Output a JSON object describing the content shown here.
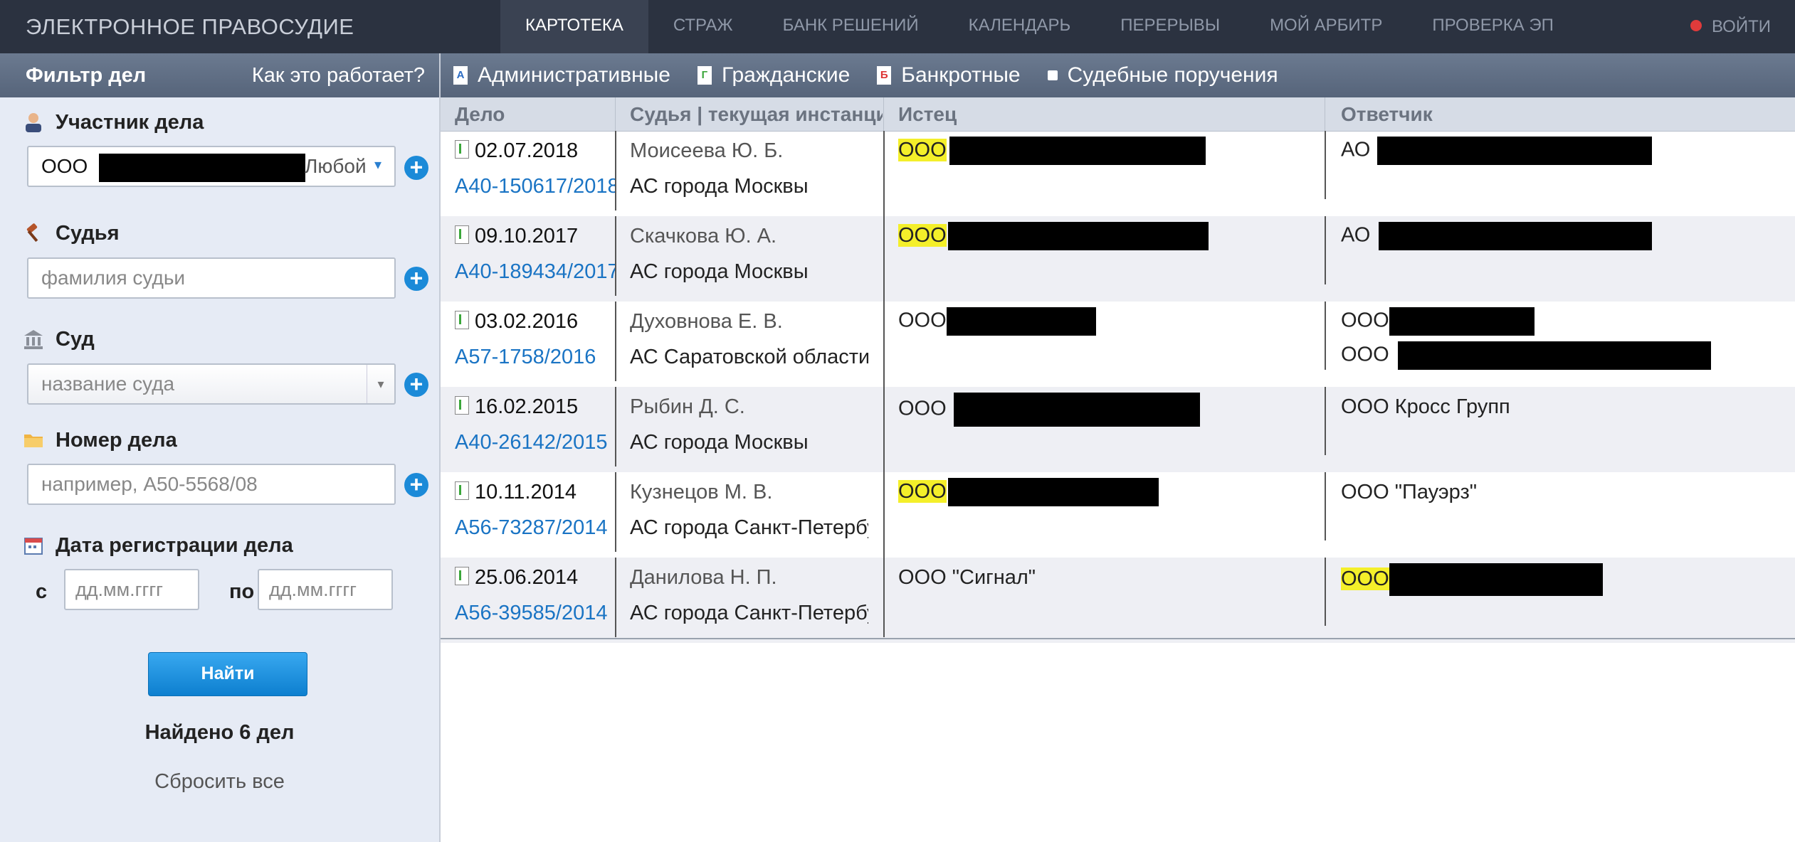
{
  "header": {
    "brand": "ЭЛЕКТРОННОЕ ПРАВОСУДИЕ",
    "nav": [
      "КАРТОТЕКА",
      "СТРАЖ",
      "БАНК РЕШЕНИЙ",
      "КАЛЕНДАРЬ",
      "ПЕРЕРЫВЫ",
      "МОЙ АРБИТР",
      "ПРОВЕРКА ЭП"
    ],
    "active_nav": "КАРТОТЕКА",
    "login": "ВОЙТИ"
  },
  "sidebar": {
    "title": "Фильтр дел",
    "how": "Как это работает?",
    "participant_label": "Участник дела",
    "participant_value": "ООО",
    "participant_role": "Любой",
    "judge_label": "Судья",
    "judge_placeholder": "фамилия судьи",
    "court_label": "Суд",
    "court_placeholder": "название суда",
    "case_label": "Номер дела",
    "case_placeholder": "например, А50-5568/08",
    "date_label": "Дата регистрации дела",
    "date_from": "с",
    "date_to": "по",
    "date_placeholder": "дд.мм.гггг",
    "find_button": "Найти",
    "found": "Найдено 6 дел",
    "reset": "Сбросить все"
  },
  "tabs": [
    {
      "label": "Административные",
      "icon": "А"
    },
    {
      "label": "Гражданские",
      "icon": "Г"
    },
    {
      "label": "Банкротные",
      "icon": "Б"
    },
    {
      "label": "Судебные поручения",
      "icon": ""
    }
  ],
  "table": {
    "columns": [
      "Дело",
      "Судья | текущая инстанция",
      "Истец",
      "Ответчик"
    ],
    "rows": [
      {
        "date": "02.07.2018",
        "number": "А40-150617/2018",
        "judge": "Моисеева Ю. Б.",
        "court": "АС города Москвы",
        "plaintiff": "ООО",
        "plaintiff_hl": true,
        "defendant": [
          "АО"
        ],
        "defendant_hl": false
      },
      {
        "date": "09.10.2017",
        "number": "А40-189434/2017",
        "judge": "Скачкова Ю. А.",
        "court": "АС города Москвы",
        "plaintiff": "ООО",
        "plaintiff_hl": true,
        "defendant": [
          "АО"
        ],
        "defendant_hl": false
      },
      {
        "date": "03.02.2016",
        "number": "А57-1758/2016",
        "judge": "Духовнова Е. В.",
        "court": "АС Саратовской области",
        "plaintiff": "ООО",
        "plaintiff_hl": false,
        "defendant": [
          "ООО",
          "ООО"
        ],
        "defendant_hl": false
      },
      {
        "date": "16.02.2015",
        "number": "А40-26142/2015",
        "judge": "Рыбин Д. С.",
        "court": "АС города Москвы",
        "plaintiff": "ООО",
        "plaintiff_hl": false,
        "defendant": [
          "ООО Кросс Групп"
        ],
        "defendant_hl": false
      },
      {
        "date": "10.11.2014",
        "number": "А56-73287/2014",
        "judge": "Кузнецов М. В.",
        "court": "АС города Санкт-Петербурга",
        "plaintiff": "ООО",
        "plaintiff_hl": true,
        "defendant": [
          "ООО \"Пауэрз\""
        ],
        "defendant_hl": false
      },
      {
        "date": "25.06.2014",
        "number": "А56-39585/2014",
        "judge": "Данилова Н. П.",
        "court": "АС города Санкт-Петербурга",
        "plaintiff": "ООО \"Сигнал\"",
        "plaintiff_hl": false,
        "defendant": [
          "ООО"
        ],
        "defendant_hl": true
      }
    ]
  }
}
